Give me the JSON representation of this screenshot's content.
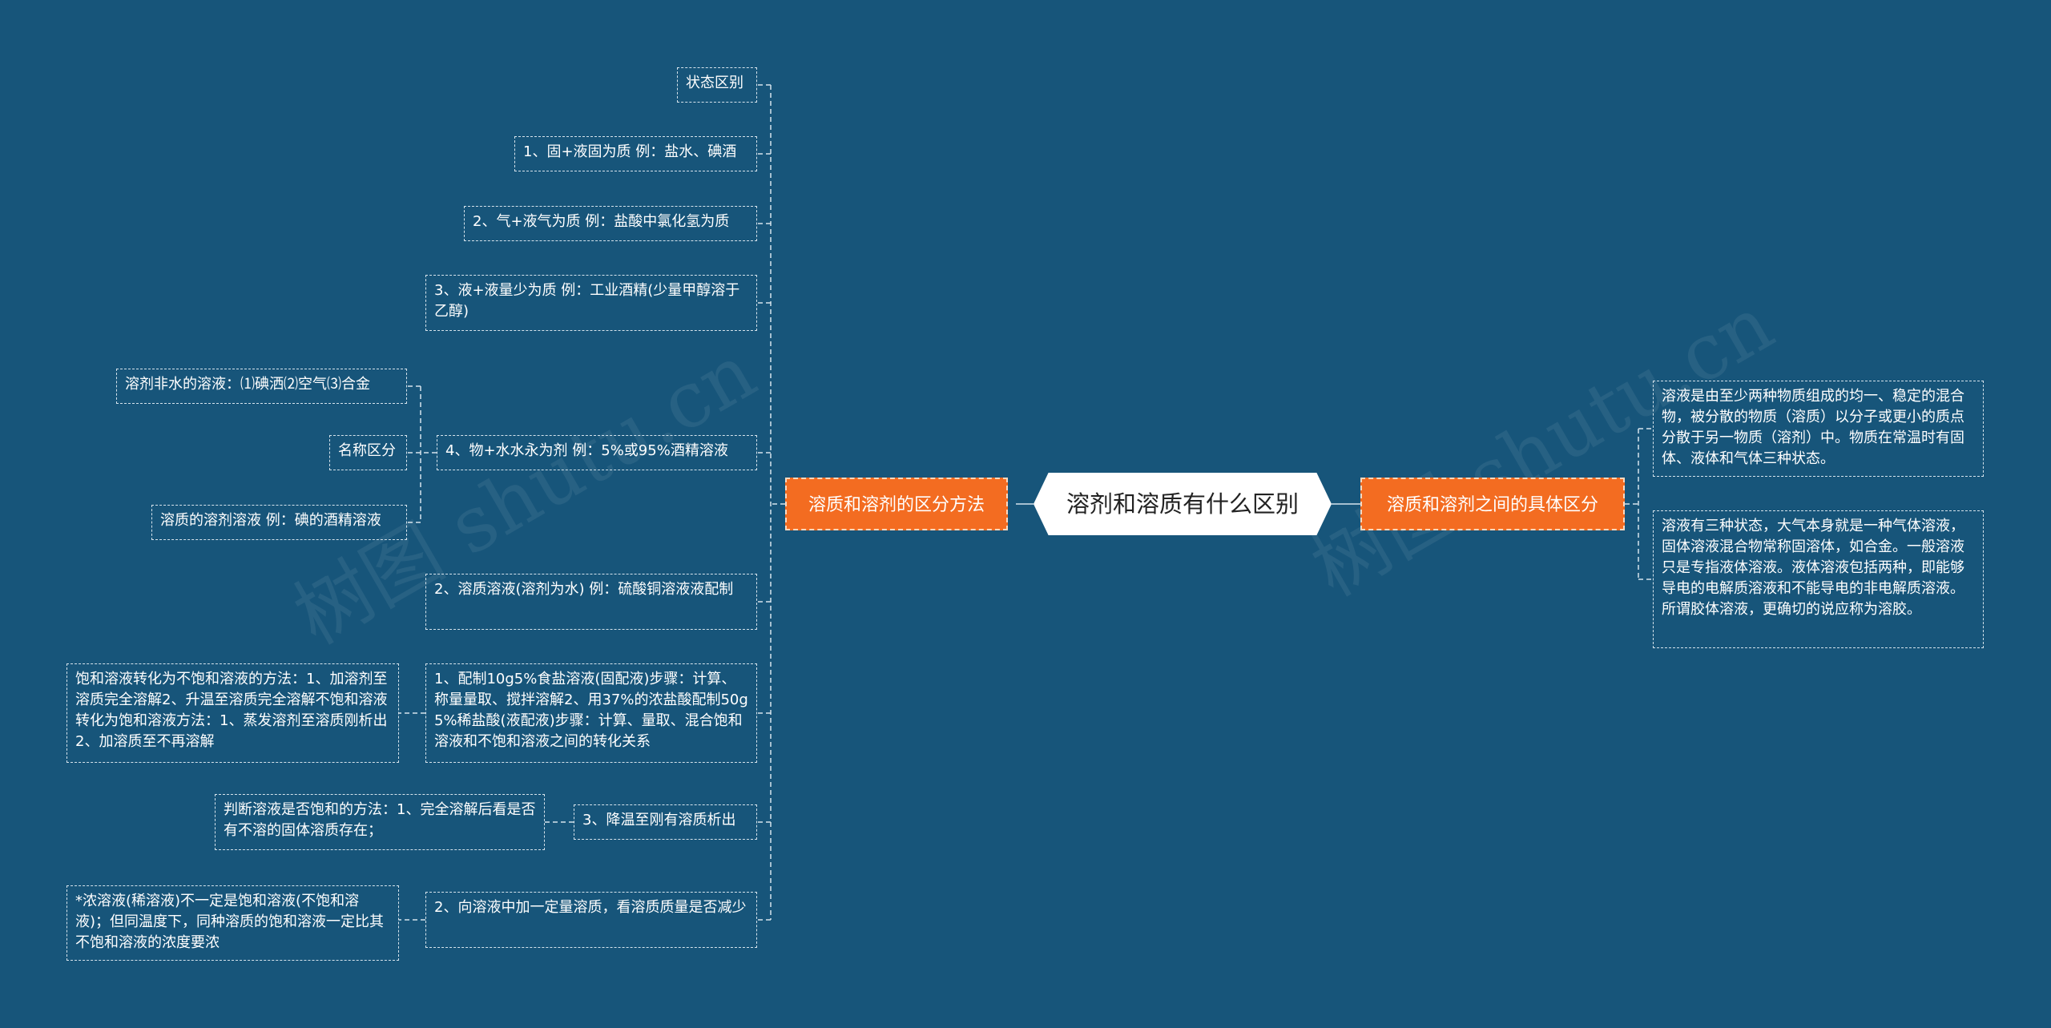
{
  "center": "溶剂和溶质有什么区别",
  "branches": {
    "left": "溶质和溶剂的区分方法",
    "right": "溶质和溶剂之间的具体区分"
  },
  "nodes": {
    "state_diff": "状态区别",
    "solid_liquid": "1、固+液固为质 例：盐水、碘酒",
    "gas_liquid": "2、气+液气为质 例：盐酸中氯化氢为质",
    "liquid_liquid": "3、液+液量少为质 例：工业酒精(少量甲醇溶于乙醇)",
    "water_solvent": "4、物+水水永为剂 例：5%或95%酒精溶液",
    "non_water": "溶剂非水的溶液：⑴碘洒⑵空气⑶合金",
    "name_diff": "名称区分",
    "solute_solvent_name": "溶质的溶剂溶液 例：碘的酒精溶液",
    "solute_solution": "2、溶质溶液(溶剂为水) 例：硫酸铜溶液液配制",
    "prep_steps": "1、配制10g5%食盐溶液(固配液)步骤：计算、称量量取、搅拌溶解2、用37%的浓盐酸配制50g5%稀盐酸(液配液)步骤：计算、量取、混合饱和溶液和不饱和溶液之间的转化关系",
    "conversion": "饱和溶液转化为不饱和溶液的方法：1、加溶剂至溶质完全溶解2、升温至溶质完全溶解不饱和溶液转化为饱和溶液方法：1、蒸发溶剂至溶质刚析出2、加溶质至不再溶解",
    "cool": "3、降温至刚有溶质析出",
    "judge": "判断溶液是否饱和的方法：1、完全溶解后看是否有不溶的固体溶质存在；",
    "add_solute": "2、向溶液中加一定量溶质，看溶质质量是否减少",
    "concentration": "*浓溶液(稀溶液)不一定是饱和溶液(不饱和溶液)；但同温度下，同种溶质的饱和溶液一定比其不饱和溶液的浓度要浓",
    "def_solution": "溶液是由至少两种物质组成的均一、稳定的混合物，被分散的物质（溶质）以分子或更小的质点分散于另一物质（溶剂）中。物质在常温时有固体、液体和气体三种状态。",
    "three_states": "溶液有三种状态，大气本身就是一种气体溶液，固体溶液混合物常称固溶体，如合金。一般溶液只是专指液体溶液。液体溶液包括两种，即能够导电的电解质溶液和不能导电的非电解质溶液。所谓胶体溶液，更确切的说应称为溶胶。"
  },
  "watermarks": [
    "树图 shutu.cn",
    "树图 shutu.cn"
  ],
  "colors": {
    "background": "#17557a",
    "branch": "#f36c21",
    "center": "#ffffff",
    "line": "#d6e3ec"
  }
}
